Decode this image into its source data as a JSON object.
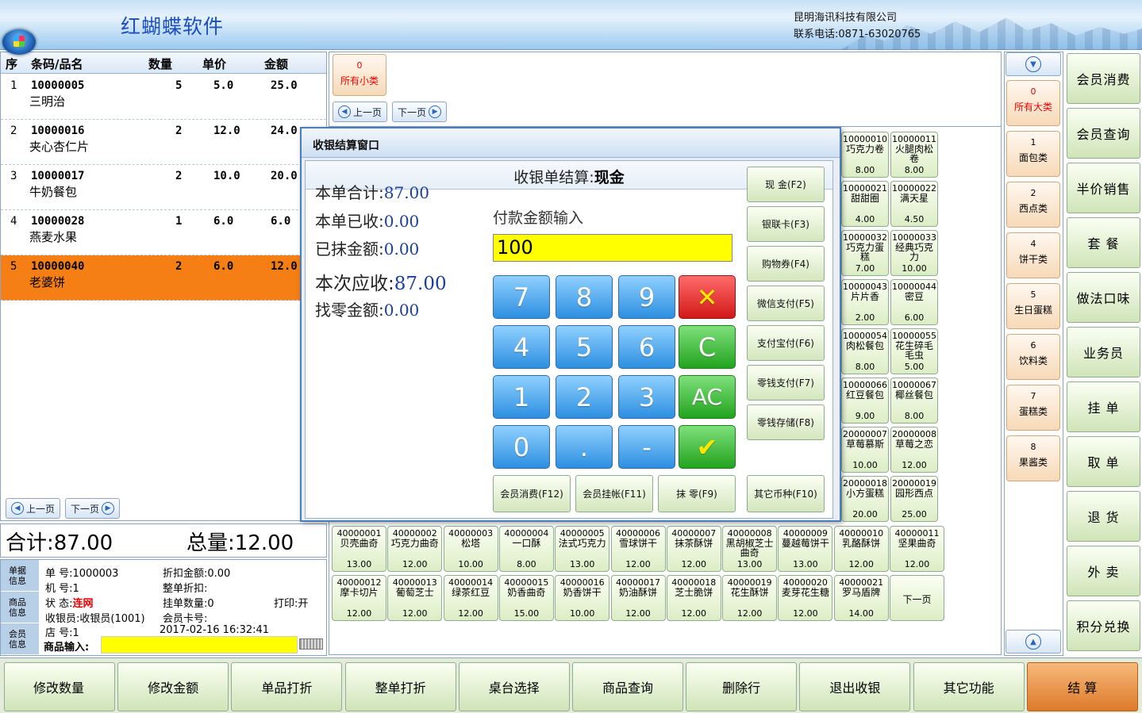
{
  "header": {
    "brand": "红蝴蝶软件",
    "company": "昆明海讯科技有限公司",
    "contact": "联系电话:0871-63020765"
  },
  "order": {
    "columns": {
      "seq": "序",
      "code": "条码/品名",
      "qty": "数量",
      "price": "单价",
      "amount": "金额"
    },
    "rows": [
      {
        "seq": "1",
        "code": "10000005",
        "name": "三明治",
        "qty": "5",
        "price": "5.0",
        "amount": "25.0"
      },
      {
        "seq": "2",
        "code": "10000016",
        "name": "夹心杏仁片",
        "qty": "2",
        "price": "12.0",
        "amount": "24.0"
      },
      {
        "seq": "3",
        "code": "10000017",
        "name": "牛奶餐包",
        "qty": "2",
        "price": "10.0",
        "amount": "20.0"
      },
      {
        "seq": "4",
        "code": "10000028",
        "name": "燕麦水果",
        "qty": "1",
        "price": "6.0",
        "amount": "6.0"
      },
      {
        "seq": "5",
        "code": "10000040",
        "name": "老婆饼",
        "qty": "2",
        "price": "6.0",
        "amount": "12.0"
      }
    ],
    "prev_label": "上一页",
    "next_label": "下一页"
  },
  "totals": {
    "sum": "合计:87.00",
    "total_qty": "总量:12.00"
  },
  "info": {
    "tab_order": "单据\n信息",
    "tab_goods": "商品\n信息",
    "tab_member": "会员\n信息",
    "order_no": "单  号:1000003",
    "machine_no": "机  号:1",
    "status_label": "状  态:",
    "status_value": "连网",
    "cashier": "收银员:收银员(1001)",
    "store_no": "店  号:1",
    "discount_amount": "折扣金额:0.00",
    "order_discount": "整单折扣:",
    "held_count": "挂单数量:0",
    "print_flag": "打印:开",
    "member_card": "会员卡号:",
    "datetime": "2017-02-16 16:32:41",
    "scan_label": "商品输入:"
  },
  "subcategory": {
    "count": "0",
    "label": "所有小类"
  },
  "sub_pager": {
    "prev": "上一页",
    "next": "下一页"
  },
  "categories": [
    {
      "count": "0",
      "label": "所有大类"
    },
    {
      "count": "1",
      "label": "面包类"
    },
    {
      "count": "2",
      "label": "西点类"
    },
    {
      "count": "4",
      "label": "饼干类"
    },
    {
      "count": "5",
      "label": "生日蛋糕"
    },
    {
      "count": "6",
      "label": "饮料类"
    },
    {
      "count": "7",
      "label": "蛋糕类"
    },
    {
      "count": "8",
      "label": "果酱类"
    }
  ],
  "products_right": [
    {
      "code": "10000010",
      "name": "巧克力卷",
      "price": "8.00"
    },
    {
      "code": "10000011",
      "name": "火腿肉松卷",
      "price": "8.00"
    },
    {
      "code": "10000021",
      "name": "甜甜圈",
      "price": "4.00"
    },
    {
      "code": "10000022",
      "name": "满天星",
      "price": "4.50"
    },
    {
      "code": "10000032",
      "name": "巧克力蛋糕",
      "price": "7.00"
    },
    {
      "code": "10000033",
      "name": "经典巧克力",
      "price": "10.00"
    },
    {
      "code": "10000043",
      "name": "片片香",
      "price": "2.00"
    },
    {
      "code": "10000044",
      "name": "密豆",
      "price": "6.00"
    },
    {
      "code": "10000054",
      "name": "肉松餐包",
      "price": "8.00"
    },
    {
      "code": "10000055",
      "name": "花生碎毛毛虫",
      "price": "5.00"
    },
    {
      "code": "10000066",
      "name": "红豆餐包",
      "price": "9.00"
    },
    {
      "code": "10000067",
      "name": "椰丝餐包",
      "price": "8.00"
    },
    {
      "code": "20000007",
      "name": "草莓慕斯",
      "price": "10.00"
    },
    {
      "code": "20000008",
      "name": "草莓之恋",
      "price": "12.00"
    },
    {
      "code": "20000018",
      "name": "小方蛋糕",
      "price": "20.00"
    },
    {
      "code": "20000019",
      "name": "园形西点",
      "price": "25.00"
    }
  ],
  "products_bottom": [
    {
      "code": "40000001",
      "name": "贝壳曲奇",
      "price": "13.00"
    },
    {
      "code": "40000002",
      "name": "巧克力曲奇",
      "price": "12.00"
    },
    {
      "code": "40000003",
      "name": "松塔",
      "price": "10.00"
    },
    {
      "code": "40000004",
      "name": "一口酥",
      "price": "8.00"
    },
    {
      "code": "40000005",
      "name": "法式巧克力",
      "price": "13.00"
    },
    {
      "code": "40000006",
      "name": "雪球饼干",
      "price": "12.00"
    },
    {
      "code": "40000007",
      "name": "抹茶酥饼",
      "price": "12.00"
    },
    {
      "code": "40000008",
      "name": "黑胡椒芝士曲奇",
      "price": "13.00"
    },
    {
      "code": "40000009",
      "name": "蔓越莓饼干",
      "price": "13.00"
    },
    {
      "code": "40000010",
      "name": "乳酪酥饼",
      "price": "12.00"
    },
    {
      "code": "40000011",
      "name": "坚果曲奇",
      "price": "12.00"
    },
    {
      "code": "40000012",
      "name": "摩卡切片",
      "price": "12.00"
    },
    {
      "code": "40000013",
      "name": "葡萄芝士",
      "price": "12.00"
    },
    {
      "code": "40000014",
      "name": "绿茶红豆",
      "price": "12.00"
    },
    {
      "code": "40000015",
      "name": "奶香曲奇",
      "price": "15.00"
    },
    {
      "code": "40000016",
      "name": "奶香饼干",
      "price": "10.00"
    },
    {
      "code": "40000017",
      "name": "奶油酥饼",
      "price": "12.00"
    },
    {
      "code": "40000018",
      "name": "芝士脆饼",
      "price": "12.00"
    },
    {
      "code": "40000019",
      "name": "花生酥饼",
      "price": "12.00"
    },
    {
      "code": "40000020",
      "name": "麦芽花生糖",
      "price": "12.00"
    },
    {
      "code": "40000021",
      "name": "罗马盾牌",
      "price": "14.00"
    }
  ],
  "products_next": "下一页",
  "functions": [
    "会员消费",
    "会员查询",
    "半价销售",
    "套  餐",
    "做法口味",
    "业务员",
    "挂  单",
    "取  单",
    "退  货",
    "外  卖",
    "积分兑换"
  ],
  "bottom": [
    "修改数量",
    "修改金额",
    "单品打折",
    "整单打折",
    "桌台选择",
    "商品查询",
    "删除行",
    "退出收银",
    "其它功能",
    "结  算"
  ],
  "modal": {
    "title": "收银结算窗口",
    "subtitle_prefix": "收银单结算:",
    "subtitle_method": "现金",
    "lines": [
      {
        "label": "本单合计:",
        "value": "87.00"
      },
      {
        "label": "本单已收:",
        "value": "0.00"
      },
      {
        "label": "已抹金额:",
        "value": "0.00"
      },
      {
        "label": "本次应收:",
        "value": "87.00"
      },
      {
        "label": "找零金额:",
        "value": "0.00"
      }
    ],
    "pay_label": "付款金额输入",
    "pay_value": "100",
    "keys": [
      "7",
      "8",
      "9",
      "4",
      "5",
      "6",
      "1",
      "2",
      "3",
      "0",
      ".",
      "-"
    ],
    "key_clear": "C",
    "key_all_clear": "AC",
    "pay_methods": [
      "现  金(F2)",
      "银联卡(F3)",
      "购物券(F4)",
      "微信支付(F5)",
      "支付宝付(F6)",
      "零钱支付(F7)",
      "零钱存储(F8)"
    ],
    "bottom_buttons": [
      "会员消费(F12)",
      "会员挂帐(F11)",
      "抹  零(F9)",
      "其它币种(F10)"
    ]
  }
}
